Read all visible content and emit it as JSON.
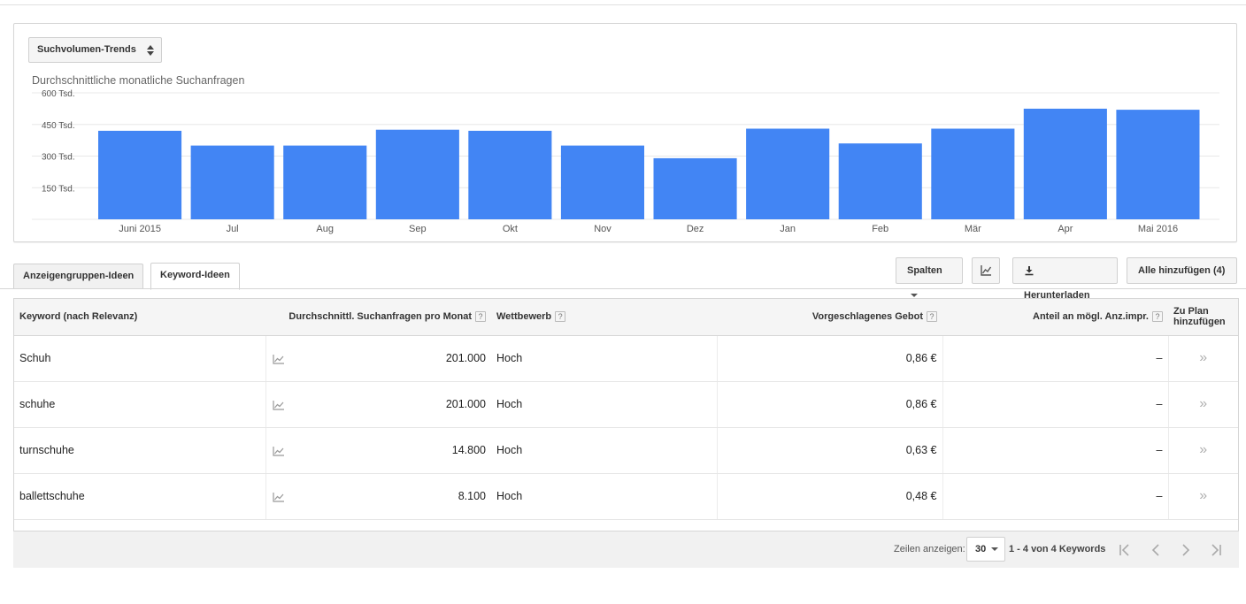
{
  "chart_panel": {
    "selector_label": "Suchvolumen-Trends",
    "subtitle": "Durchschnittliche monatliche Suchanfragen"
  },
  "chart_data": {
    "type": "bar",
    "title": "Durchschnittliche monatliche Suchanfragen",
    "categories": [
      "Juni 2015",
      "Jul",
      "Aug",
      "Sep",
      "Okt",
      "Nov",
      "Dez",
      "Jan",
      "Feb",
      "Mär",
      "Apr",
      "Mai 2016"
    ],
    "values": [
      420000,
      350000,
      350000,
      425000,
      420000,
      350000,
      290000,
      430000,
      360000,
      430000,
      525000,
      520000
    ],
    "ylim": [
      0,
      600000
    ],
    "yticks": [
      150000,
      300000,
      450000,
      600000
    ],
    "ytick_labels": [
      "150 Tsd.",
      "300 Tsd.",
      "450 Tsd.",
      "600 Tsd."
    ],
    "grid": true,
    "color": "#4285f4"
  },
  "tabs": [
    {
      "label": "Anzeigengruppen-Ideen",
      "active": false
    },
    {
      "label": "Keyword-Ideen",
      "active": true
    }
  ],
  "toolbar": {
    "columns_label": "Spalten",
    "chart_icon": "line-chart-icon",
    "download_label": "Herunterladen",
    "add_all_label": "Alle hinzufügen (4)"
  },
  "table": {
    "headers": {
      "keyword": "Keyword (nach Relevanz)",
      "searches": "Durchschnittl. Suchanfragen pro Monat",
      "competition": "Wettbewerb",
      "bid": "Vorgeschlagenes Gebot",
      "impr_share": "Anteil an mögl. Anz.impr.",
      "add_to_plan": "Zu Plan hinzufügen"
    },
    "help_mark": "?",
    "rows": [
      {
        "keyword": "Schuh",
        "searches": "201.000",
        "competition": "Hoch",
        "bid": "0,86 €",
        "impr_share": "–",
        "add": "»"
      },
      {
        "keyword": "schuhe",
        "searches": "201.000",
        "competition": "Hoch",
        "bid": "0,86 €",
        "impr_share": "–",
        "add": "»"
      },
      {
        "keyword": "turnschuhe",
        "searches": "14.800",
        "competition": "Hoch",
        "bid": "0,63 €",
        "impr_share": "–",
        "add": "»"
      },
      {
        "keyword": "ballettschuhe",
        "searches": "8.100",
        "competition": "Hoch",
        "bid": "0,48 €",
        "impr_share": "–",
        "add": "»"
      }
    ]
  },
  "footer": {
    "rows_label": "Zeilen anzeigen:",
    "rows_value": "30",
    "range_text": "1 - 4 von 4 Keywords"
  },
  "colors": {
    "bar": "#4285f4",
    "border": "#d6d6d6",
    "footer_bg": "#f1f1f1"
  }
}
